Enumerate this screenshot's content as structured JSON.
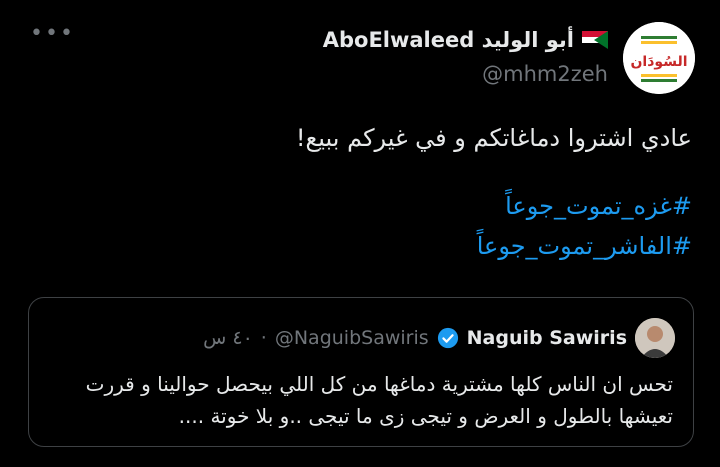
{
  "tweet": {
    "display_name": "AboElwaleed أبو الوليد",
    "flag_icon": "sudan-flag-icon",
    "handle": "@mhm2zeh",
    "avatar_text": "السُودَان",
    "more_label": "•••",
    "text_line": "عادي اشتروا دماغاتكم و في غيركم ببيع!",
    "hashtags": [
      "#غزه_تموت_جوعاً",
      "#الفاشر_تموت_جوعاً"
    ]
  },
  "quoted": {
    "name": "Naguib Sawiris",
    "handle": "@NaguibSawiris",
    "separator": "·",
    "time": "٤٠ س",
    "verified_icon": "verified-badge-icon",
    "text": "تحس ان الناس كلها مشترية دماغها من كل اللي بيحصل حوالينا و قررت تعيشها بالطول و العرض و تيجى زى ما تيجى ..و بلا خوتة ...."
  },
  "colors": {
    "background": "#000000",
    "text": "#e7e9ea",
    "secondary": "#71767b",
    "link": "#1d9bf0",
    "border": "#3e4144",
    "verified": "#1d9bf0"
  }
}
